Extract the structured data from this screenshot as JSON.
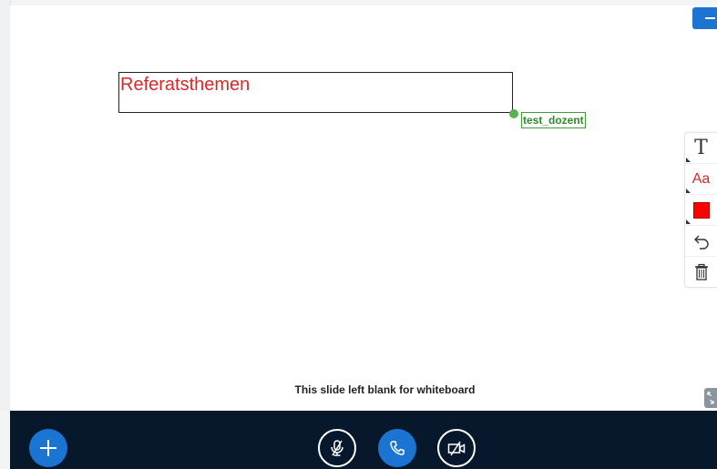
{
  "whiteboard": {
    "text_box_content": "Referatsthemen",
    "cursor_user_label": "test_dozent",
    "blank_slide_message": "This slide left blank for whiteboard"
  },
  "toolbar": {
    "text_tool_glyph": "T",
    "font_size_glyph": "Aa"
  },
  "colors": {
    "accent": "#1b74d2",
    "actions_bar_bg": "#07182c",
    "text_red": "#d62a2a",
    "selected_color": "#ff0000",
    "cursor_green": "#58b052"
  },
  "icons": {
    "add": "plus-icon",
    "mic": "microphone-muted-icon",
    "phone": "phone-icon",
    "camera": "camera-off-icon",
    "undo": "undo-icon",
    "clear": "trash-icon",
    "minimize": "minus-icon",
    "fullscreen": "fullscreen-icon"
  }
}
